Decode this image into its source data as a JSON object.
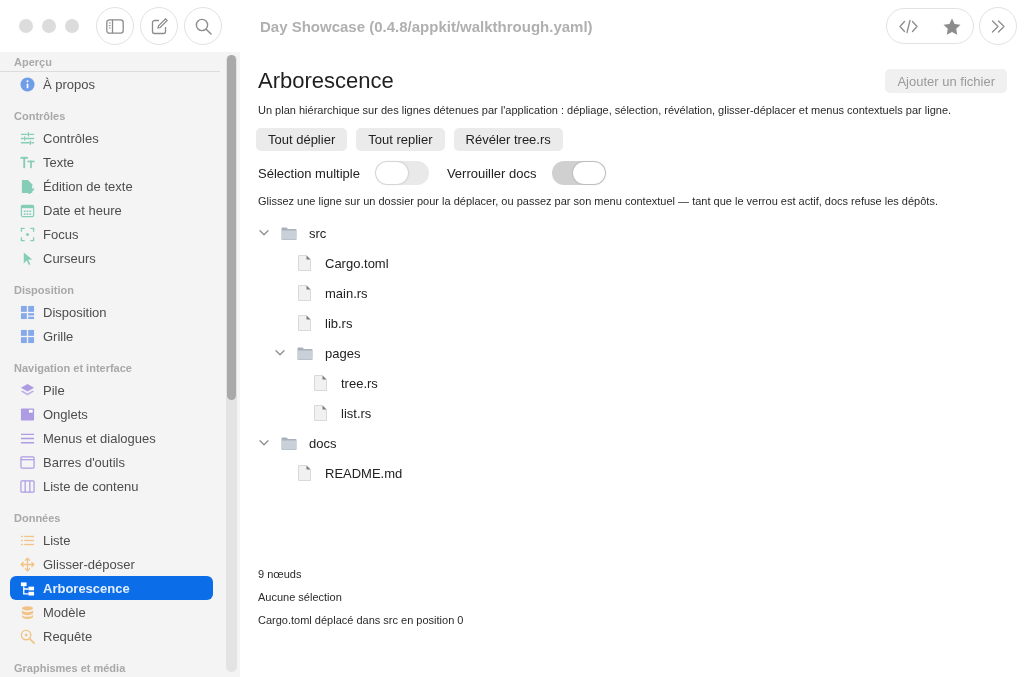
{
  "window": {
    "title": "Day Showcase (0.4.8/appkit/walkthrough.yaml)"
  },
  "sidebar": {
    "sections": [
      {
        "title": "Aperçu",
        "items": [
          {
            "label": "À propos",
            "selected": false
          }
        ]
      },
      {
        "title": "Contrôles",
        "items": [
          {
            "label": "Contrôles",
            "selected": false
          },
          {
            "label": "Texte",
            "selected": false
          },
          {
            "label": "Édition de texte",
            "selected": false
          },
          {
            "label": "Date et heure",
            "selected": false
          },
          {
            "label": "Focus",
            "selected": false
          },
          {
            "label": "Curseurs",
            "selected": false
          }
        ]
      },
      {
        "title": "Disposition",
        "items": [
          {
            "label": "Disposition",
            "selected": false
          },
          {
            "label": "Grille",
            "selected": false
          }
        ]
      },
      {
        "title": "Navigation et interface",
        "items": [
          {
            "label": "Pile",
            "selected": false
          },
          {
            "label": "Onglets",
            "selected": false
          },
          {
            "label": "Menus et dialogues",
            "selected": false
          },
          {
            "label": "Barres d'outils",
            "selected": false
          },
          {
            "label": "Liste de contenu",
            "selected": false
          }
        ]
      },
      {
        "title": "Données",
        "items": [
          {
            "label": "Liste",
            "selected": false
          },
          {
            "label": "Glisser-déposer",
            "selected": false
          },
          {
            "label": "Arborescence",
            "selected": true
          },
          {
            "label": "Modèle",
            "selected": false
          },
          {
            "label": "Requête",
            "selected": false
          }
        ]
      },
      {
        "title": "Graphismes et média"
      }
    ]
  },
  "page": {
    "title": "Arborescence",
    "add_button": {
      "label": "Ajouter un fichier",
      "disabled": true
    },
    "description": "Un plan hiérarchique sur des lignes détenues par l'application : dépliage, sélection, révélation, glisser-déplacer et menus contextuels par ligne.",
    "actions": [
      "Tout déplier",
      "Tout replier",
      "Révéler tree.rs"
    ],
    "toggles": [
      {
        "label": "Sélection multiple",
        "on": false
      },
      {
        "label": "Verrouiller docs",
        "on": true
      }
    ],
    "hint": "Glissez une ligne sur un dossier pour la déplacer, ou passez par son menu contextuel — tant que le verrou est actif, docs refuse les dépôts.",
    "tree": [
      {
        "label": "src",
        "kind": "folder",
        "expanded": true,
        "selected": false,
        "children": [
          {
            "label": "Cargo.toml",
            "kind": "file",
            "selected": false
          },
          {
            "label": "main.rs",
            "kind": "file",
            "selected": false
          },
          {
            "label": "lib.rs",
            "kind": "file",
            "selected": false
          },
          {
            "label": "pages",
            "kind": "folder",
            "expanded": true,
            "selected": false,
            "children": [
              {
                "label": "tree.rs",
                "kind": "file",
                "selected": false
              },
              {
                "label": "list.rs",
                "kind": "file",
                "selected": false
              }
            ]
          }
        ]
      },
      {
        "label": "docs",
        "kind": "folder",
        "expanded": true,
        "selected": false,
        "children": [
          {
            "label": "README.md",
            "kind": "file",
            "selected": false
          }
        ]
      }
    ],
    "status": [
      "9 nœuds",
      "Aucune sélection",
      "Cargo.toml déplacé dans src en position 0"
    ]
  }
}
